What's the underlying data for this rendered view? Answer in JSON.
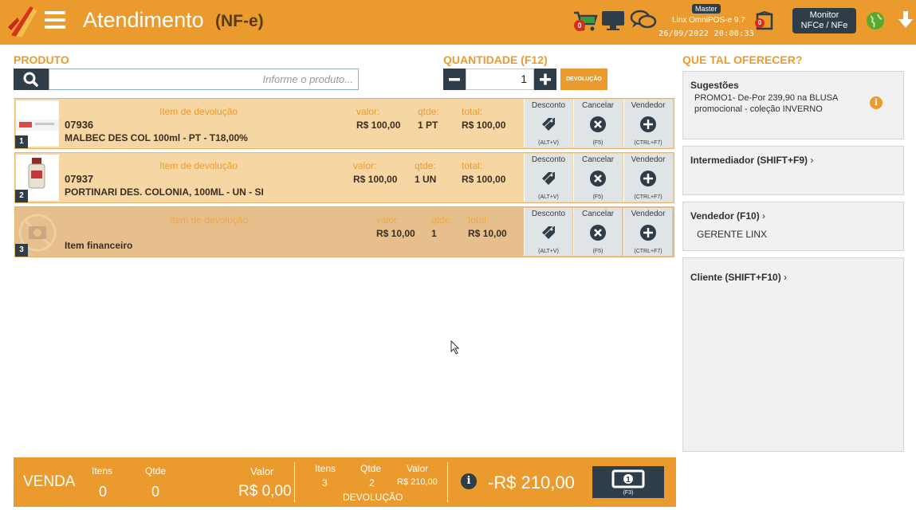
{
  "header": {
    "title": "Atendimento",
    "subtitle": "(NF-e)",
    "cart_count": "0",
    "box_count": "0",
    "role": "Master",
    "pos_version": "Linx OmniPOS-e  9.7",
    "datetime": "26/09/2022 20:00:33",
    "monitor_label_1": "Monitor",
    "monitor_label_2": "NFCe / NFe"
  },
  "produto": {
    "label": "PRODUTO",
    "placeholder": "Informe o produto..."
  },
  "quantidade": {
    "label": "QUANTIDADE (F12)",
    "value": "1",
    "devolucao_label": "DEVOLUÇÃO"
  },
  "items": [
    {
      "num": "1",
      "tag": "Item de devolução",
      "code": "07936",
      "desc": "MALBEC DES COL 100ml - PT - T18,00%",
      "valor_label": "valor:",
      "valor": "R$ 100,00",
      "qtde_label": "qtde:",
      "qtde": "1 PT",
      "total_label": "total:",
      "total": "R$ 100,00"
    },
    {
      "num": "2",
      "tag": "Item de devolução",
      "code": "07937",
      "desc": "PORTINARI DES. COLONIA, 100ML - UN - SI",
      "valor_label": "valor:",
      "valor": "R$ 100,00",
      "qtde_label": "qtde:",
      "qtde": "1 UN",
      "total_label": "total:",
      "total": "R$ 100,00"
    },
    {
      "num": "3",
      "tag": "Item de devolução",
      "desc": "Item financeiro",
      "valor_label": "valor:",
      "valor": "R$ 10,00",
      "qtde_label": "qtde:",
      "qtde": "1",
      "total_label": "total:",
      "total": "R$ 10,00"
    }
  ],
  "actions": {
    "desconto": "Desconto",
    "desconto_key": "(ALT+V)",
    "cancelar": "Cancelar",
    "cancelar_key": "(F5)",
    "vendedor": "Vendedor",
    "vendedor_key": "(CTRL+F7)"
  },
  "side": {
    "label": "QUE TAL OFERECER?",
    "sugestoes_title": "Sugestões",
    "sugestao_line1": "PROMO1- De-Por 239,90 na BLUSA",
    "sugestao_line2": "promocional - coleção INVERNO",
    "intermediador": "Intermediador (SHIFT+F9)",
    "vendedor": "Vendedor (F10)",
    "vendedor_name": "GERENTE LINX",
    "cliente": "Cliente (SHIFT+F10)"
  },
  "footer": {
    "venda": "VENDA",
    "itens_label": "Itens",
    "itens": "0",
    "qtde_label": "Qtde",
    "qtde": "0",
    "valor_label": "Valor",
    "valor": "R$ 0,00",
    "dev_itens_label": "Itens",
    "dev_itens": "3",
    "dev_qtde_label": "Qtde",
    "dev_qtde": "2",
    "dev_valor_label": "Valor",
    "dev_valor": "R$ 210,00",
    "devolucao": "DEVOLUÇÃO",
    "total": "-R$ 210,00",
    "pay_key": "(F3)"
  },
  "colors": {
    "accent": "#eb9b2e",
    "dark": "#2f3d49",
    "item_bg": "#f6d6a2"
  }
}
